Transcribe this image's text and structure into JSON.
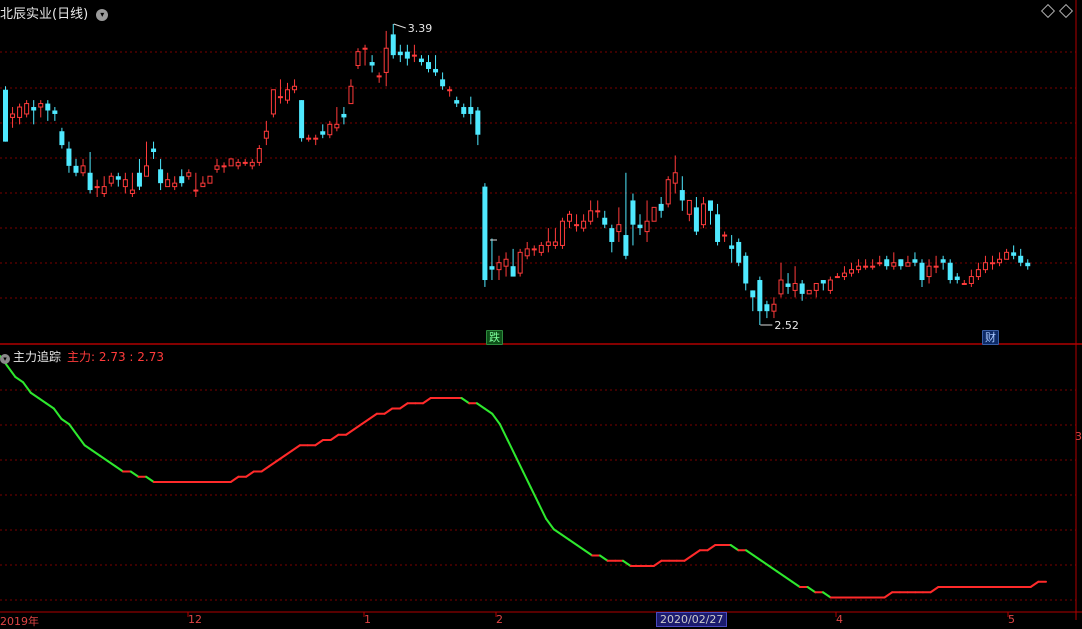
{
  "header": {
    "stock_title": "北辰实业(日线)",
    "dropdown_icon": "chevron-down-icon",
    "diamond_icon": "diamond-icon"
  },
  "colors": {
    "background": "#000000",
    "up": "#ff3b3b",
    "down": "#4fe9ff",
    "grid": "#7a0000",
    "ind_green": "#2ee82e",
    "ind_red": "#ff2a2a"
  },
  "price_chart": {
    "high_label": "3.39",
    "low_label": "2.52",
    "marker_die": "跌",
    "marker_cai": "财",
    "candles": [
      [
        3.2,
        3.05,
        3.21,
        3.05
      ],
      [
        3.12,
        3.13,
        3.15,
        3.09
      ],
      [
        3.12,
        3.15,
        3.16,
        3.1
      ],
      [
        3.13,
        3.16,
        3.17,
        3.12
      ],
      [
        3.15,
        3.14,
        3.17,
        3.1
      ],
      [
        3.15,
        3.16,
        3.17,
        3.12
      ],
      [
        3.16,
        3.14,
        3.17,
        3.11
      ],
      [
        3.14,
        3.13,
        3.15,
        3.11
      ],
      [
        3.08,
        3.04,
        3.09,
        3.03
      ],
      [
        3.03,
        2.98,
        3.05,
        2.96
      ],
      [
        2.98,
        2.96,
        3.0,
        2.95
      ],
      [
        2.96,
        2.98,
        3.0,
        2.95
      ],
      [
        2.96,
        2.91,
        3.02,
        2.9
      ],
      [
        2.92,
        2.92,
        2.94,
        2.89
      ],
      [
        2.9,
        2.92,
        2.95,
        2.89
      ],
      [
        2.93,
        2.95,
        2.96,
        2.92
      ],
      [
        2.95,
        2.94,
        2.96,
        2.92
      ],
      [
        2.92,
        2.94,
        2.96,
        2.9
      ],
      [
        2.9,
        2.91,
        2.96,
        2.89
      ],
      [
        2.96,
        2.92,
        3.0,
        2.91
      ],
      [
        2.95,
        2.98,
        3.05,
        2.95
      ],
      [
        3.03,
        3.02,
        3.05,
        3.0
      ],
      [
        2.97,
        2.93,
        3.0,
        2.91
      ],
      [
        2.92,
        2.94,
        2.96,
        2.92
      ],
      [
        2.92,
        2.93,
        2.95,
        2.91
      ],
      [
        2.95,
        2.93,
        2.97,
        2.92
      ],
      [
        2.95,
        2.96,
        2.97,
        2.94
      ],
      [
        2.91,
        2.91,
        2.96,
        2.89
      ],
      [
        2.92,
        2.93,
        2.95,
        2.92
      ],
      [
        2.93,
        2.95,
        2.95,
        2.93
      ],
      [
        2.97,
        2.98,
        3.0,
        2.96
      ],
      [
        2.98,
        2.98,
        2.99,
        2.96
      ],
      [
        2.98,
        3.0,
        3.0,
        2.98
      ],
      [
        2.98,
        2.99,
        3.0,
        2.97
      ],
      [
        2.99,
        2.99,
        3.0,
        2.98
      ],
      [
        2.98,
        2.99,
        3.0,
        2.97
      ],
      [
        2.99,
        3.03,
        3.04,
        2.98
      ],
      [
        3.06,
        3.08,
        3.11,
        3.04
      ],
      [
        3.13,
        3.2,
        3.2,
        3.12
      ],
      [
        3.18,
        3.18,
        3.23,
        3.16
      ],
      [
        3.17,
        3.2,
        3.22,
        3.16
      ],
      [
        3.2,
        3.21,
        3.23,
        3.19
      ],
      [
        3.17,
        3.06,
        3.17,
        3.05
      ],
      [
        3.06,
        3.06,
        3.07,
        3.05
      ],
      [
        3.06,
        3.06,
        3.07,
        3.04
      ],
      [
        3.08,
        3.07,
        3.1,
        3.06
      ],
      [
        3.07,
        3.1,
        3.11,
        3.06
      ],
      [
        3.09,
        3.1,
        3.15,
        3.08
      ],
      [
        3.13,
        3.12,
        3.15,
        3.1
      ],
      [
        3.16,
        3.21,
        3.23,
        3.16
      ],
      [
        3.27,
        3.31,
        3.32,
        3.26
      ],
      [
        3.32,
        3.32,
        3.33,
        3.27
      ],
      [
        3.28,
        3.27,
        3.3,
        3.25
      ],
      [
        3.24,
        3.24,
        3.25,
        3.22
      ],
      [
        3.25,
        3.32,
        3.37,
        3.21
      ],
      [
        3.36,
        3.3,
        3.39,
        3.29
      ],
      [
        3.31,
        3.3,
        3.33,
        3.28
      ],
      [
        3.31,
        3.29,
        3.33,
        3.27
      ],
      [
        3.3,
        3.3,
        3.33,
        3.28
      ],
      [
        3.29,
        3.28,
        3.3,
        3.27
      ],
      [
        3.28,
        3.26,
        3.3,
        3.25
      ],
      [
        3.26,
        3.25,
        3.3,
        3.24
      ],
      [
        3.23,
        3.21,
        3.25,
        3.2
      ],
      [
        3.2,
        3.2,
        3.21,
        3.18
      ],
      [
        3.17,
        3.16,
        3.18,
        3.15
      ],
      [
        3.15,
        3.13,
        3.16,
        3.12
      ],
      [
        3.15,
        3.13,
        3.18,
        3.1
      ],
      [
        3.14,
        3.07,
        3.15,
        3.04
      ],
      [
        2.92,
        2.65,
        2.93,
        2.63
      ],
      [
        2.69,
        2.68,
        2.77,
        2.65
      ],
      [
        2.68,
        2.7,
        2.72,
        2.65
      ],
      [
        2.69,
        2.71,
        2.73,
        2.66
      ],
      [
        2.69,
        2.66,
        2.74,
        2.66
      ],
      [
        2.67,
        2.73,
        2.74,
        2.66
      ],
      [
        2.72,
        2.74,
        2.76,
        2.71
      ],
      [
        2.74,
        2.74,
        2.75,
        2.72
      ],
      [
        2.73,
        2.75,
        2.76,
        2.72
      ],
      [
        2.75,
        2.76,
        2.8,
        2.73
      ],
      [
        2.75,
        2.76,
        2.8,
        2.74
      ],
      [
        2.75,
        2.82,
        2.83,
        2.74
      ],
      [
        2.82,
        2.84,
        2.85,
        2.8
      ],
      [
        2.81,
        2.81,
        2.84,
        2.79
      ],
      [
        2.8,
        2.82,
        2.84,
        2.79
      ],
      [
        2.82,
        2.85,
        2.88,
        2.81
      ],
      [
        2.85,
        2.85,
        2.88,
        2.83
      ],
      [
        2.83,
        2.81,
        2.85,
        2.8
      ],
      [
        2.8,
        2.76,
        2.81,
        2.73
      ],
      [
        2.79,
        2.81,
        2.86,
        2.76
      ],
      [
        2.78,
        2.72,
        2.96,
        2.71
      ],
      [
        2.88,
        2.81,
        2.9,
        2.75
      ],
      [
        2.81,
        2.8,
        2.84,
        2.78
      ],
      [
        2.79,
        2.82,
        2.88,
        2.76
      ],
      [
        2.82,
        2.86,
        2.86,
        2.82
      ],
      [
        2.87,
        2.85,
        2.89,
        2.83
      ],
      [
        2.87,
        2.94,
        2.95,
        2.86
      ],
      [
        2.93,
        2.96,
        3.01,
        2.9
      ],
      [
        2.91,
        2.88,
        2.95,
        2.85
      ],
      [
        2.84,
        2.88,
        2.88,
        2.82
      ],
      [
        2.86,
        2.79,
        2.89,
        2.78
      ],
      [
        2.81,
        2.87,
        2.89,
        2.8
      ],
      [
        2.88,
        2.85,
        2.88,
        2.81
      ],
      [
        2.84,
        2.76,
        2.87,
        2.75
      ],
      [
        2.78,
        2.78,
        2.79,
        2.76
      ],
      [
        2.75,
        2.74,
        2.78,
        2.7
      ],
      [
        2.76,
        2.7,
        2.77,
        2.69
      ],
      [
        2.72,
        2.64,
        2.73,
        2.62
      ],
      [
        2.62,
        2.6,
        2.62,
        2.56
      ],
      [
        2.65,
        2.56,
        2.66,
        2.52
      ],
      [
        2.58,
        2.56,
        2.59,
        2.54
      ],
      [
        2.56,
        2.58,
        2.6,
        2.54
      ],
      [
        2.61,
        2.65,
        2.7,
        2.6
      ],
      [
        2.64,
        2.63,
        2.67,
        2.61
      ],
      [
        2.62,
        2.64,
        2.69,
        2.6
      ],
      [
        2.64,
        2.61,
        2.65,
        2.59
      ],
      [
        2.61,
        2.62,
        2.62,
        2.61
      ],
      [
        2.62,
        2.64,
        2.64,
        2.6
      ],
      [
        2.65,
        2.64,
        2.65,
        2.62
      ],
      [
        2.62,
        2.65,
        2.66,
        2.61
      ],
      [
        2.66,
        2.66,
        2.67,
        2.66
      ],
      [
        2.66,
        2.67,
        2.69,
        2.65
      ],
      [
        2.67,
        2.68,
        2.7,
        2.66
      ],
      [
        2.68,
        2.69,
        2.71,
        2.67
      ],
      [
        2.69,
        2.69,
        2.71,
        2.68
      ],
      [
        2.69,
        2.69,
        2.71,
        2.68
      ],
      [
        2.7,
        2.7,
        2.72,
        2.69
      ],
      [
        2.71,
        2.69,
        2.72,
        2.68
      ],
      [
        2.69,
        2.7,
        2.73,
        2.68
      ],
      [
        2.71,
        2.69,
        2.71,
        2.68
      ],
      [
        2.69,
        2.7,
        2.72,
        2.69
      ],
      [
        2.71,
        2.7,
        2.73,
        2.69
      ],
      [
        2.7,
        2.65,
        2.71,
        2.63
      ],
      [
        2.66,
        2.69,
        2.71,
        2.64
      ],
      [
        2.69,
        2.69,
        2.72,
        2.67
      ],
      [
        2.71,
        2.7,
        2.72,
        2.68
      ],
      [
        2.7,
        2.65,
        2.71,
        2.64
      ],
      [
        2.66,
        2.65,
        2.67,
        2.64
      ],
      [
        2.64,
        2.64,
        2.65,
        2.64
      ],
      [
        2.64,
        2.66,
        2.68,
        2.63
      ],
      [
        2.66,
        2.68,
        2.7,
        2.65
      ],
      [
        2.68,
        2.7,
        2.72,
        2.67
      ],
      [
        2.7,
        2.7,
        2.72,
        2.68
      ],
      [
        2.7,
        2.71,
        2.73,
        2.69
      ],
      [
        2.71,
        2.73,
        2.74,
        2.71
      ],
      [
        2.73,
        2.72,
        2.75,
        2.71
      ],
      [
        2.72,
        2.7,
        2.74,
        2.69
      ],
      [
        2.7,
        2.69,
        2.71,
        2.68
      ]
    ]
  },
  "indicator": {
    "name": "主力追踪",
    "value_label": "主力: 2.73 : 2.73",
    "edge_label": "3",
    "line": [
      3.19,
      3.17,
      3.15,
      3.14,
      3.12,
      3.11,
      3.1,
      3.09,
      3.07,
      3.06,
      3.04,
      3.02,
      3.01,
      3.0,
      2.99,
      2.98,
      2.97,
      2.97,
      2.96,
      2.96,
      2.95,
      2.95,
      2.95,
      2.95,
      2.95,
      2.95,
      2.95,
      2.95,
      2.95,
      2.95,
      2.95,
      2.96,
      2.96,
      2.97,
      2.97,
      2.98,
      2.99,
      3.0,
      3.01,
      3.02,
      3.02,
      3.02,
      3.03,
      3.03,
      3.04,
      3.04,
      3.05,
      3.06,
      3.07,
      3.08,
      3.08,
      3.09,
      3.09,
      3.1,
      3.1,
      3.1,
      3.11,
      3.11,
      3.11,
      3.11,
      3.11,
      3.1,
      3.1,
      3.09,
      3.08,
      3.06,
      3.03,
      3.0,
      2.97,
      2.94,
      2.91,
      2.88,
      2.86,
      2.85,
      2.84,
      2.83,
      2.82,
      2.81,
      2.81,
      2.8,
      2.8,
      2.8,
      2.79,
      2.79,
      2.79,
      2.79,
      2.8,
      2.8,
      2.8,
      2.8,
      2.81,
      2.82,
      2.82,
      2.83,
      2.83,
      2.83,
      2.82,
      2.82,
      2.81,
      2.8,
      2.79,
      2.78,
      2.77,
      2.76,
      2.75,
      2.75,
      2.74,
      2.74,
      2.73,
      2.73,
      2.73,
      2.73,
      2.73,
      2.73,
      2.73,
      2.73,
      2.74,
      2.74,
      2.74,
      2.74,
      2.74,
      2.74,
      2.75,
      2.75,
      2.75,
      2.75,
      2.75,
      2.75,
      2.75,
      2.75,
      2.75,
      2.75,
      2.75,
      2.75,
      2.75,
      2.76,
      2.76
    ]
  },
  "time_axis": {
    "labels": [
      "2019年",
      "12",
      "1",
      "2",
      "2020/02/27",
      "4",
      "5"
    ]
  }
}
